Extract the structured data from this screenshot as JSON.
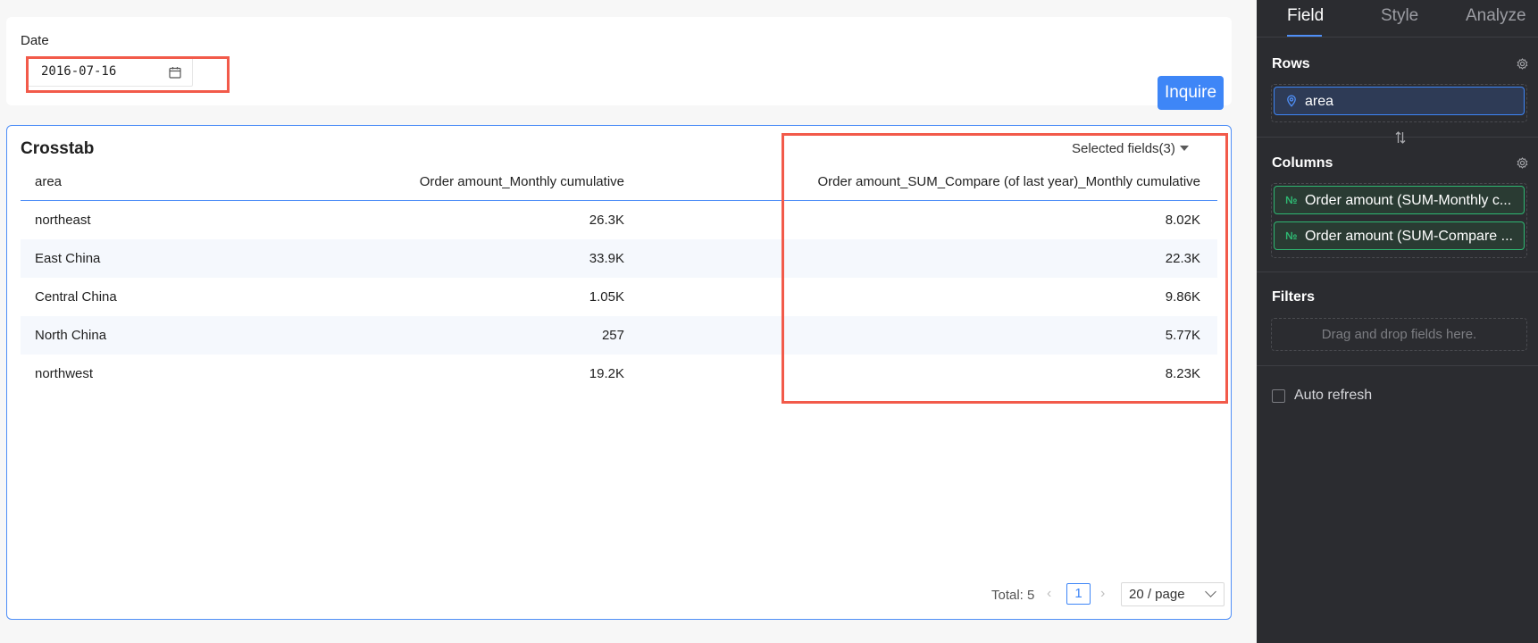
{
  "filter": {
    "label": "Date",
    "date_value": "2016-07-16",
    "inquire_label": "Inquire"
  },
  "crosstab": {
    "title": "Crosstab",
    "selected_fields": "Selected fields(3)",
    "columns": [
      "area",
      "Order amount_Monthly cumulative",
      "Order amount_SUM_Compare (of last year)_Monthly cumulative"
    ],
    "rows": [
      {
        "area": "northeast",
        "monthly": "26.3K",
        "compare": "8.02K"
      },
      {
        "area": "East China",
        "monthly": "33.9K",
        "compare": "22.3K"
      },
      {
        "area": "Central China",
        "monthly": "1.05K",
        "compare": "9.86K"
      },
      {
        "area": "North China",
        "monthly": "257",
        "compare": "5.77K"
      },
      {
        "area": "northwest",
        "monthly": "19.2K",
        "compare": "8.23K"
      }
    ],
    "pagination": {
      "total": "Total: 5",
      "current_page": "1",
      "page_size": "20 / page"
    }
  },
  "panel": {
    "tabs": [
      "Field",
      "Style",
      "Analyze"
    ],
    "active_tab": "Field",
    "rows_title": "Rows",
    "rows_fields": [
      "area"
    ],
    "columns_title": "Columns",
    "columns_fields": [
      "Order amount (SUM-Monthly c...",
      "Order amount (SUM-Compare ..."
    ],
    "filters_title": "Filters",
    "filters_placeholder": "Drag and drop fields here.",
    "auto_refresh_label": "Auto refresh",
    "auto_refresh_checked": false
  },
  "colors": {
    "accent": "#3e86f7",
    "highlight": "#f25a4a",
    "measure_green": "#2eb872",
    "panel_bg": "#2b2c30"
  }
}
